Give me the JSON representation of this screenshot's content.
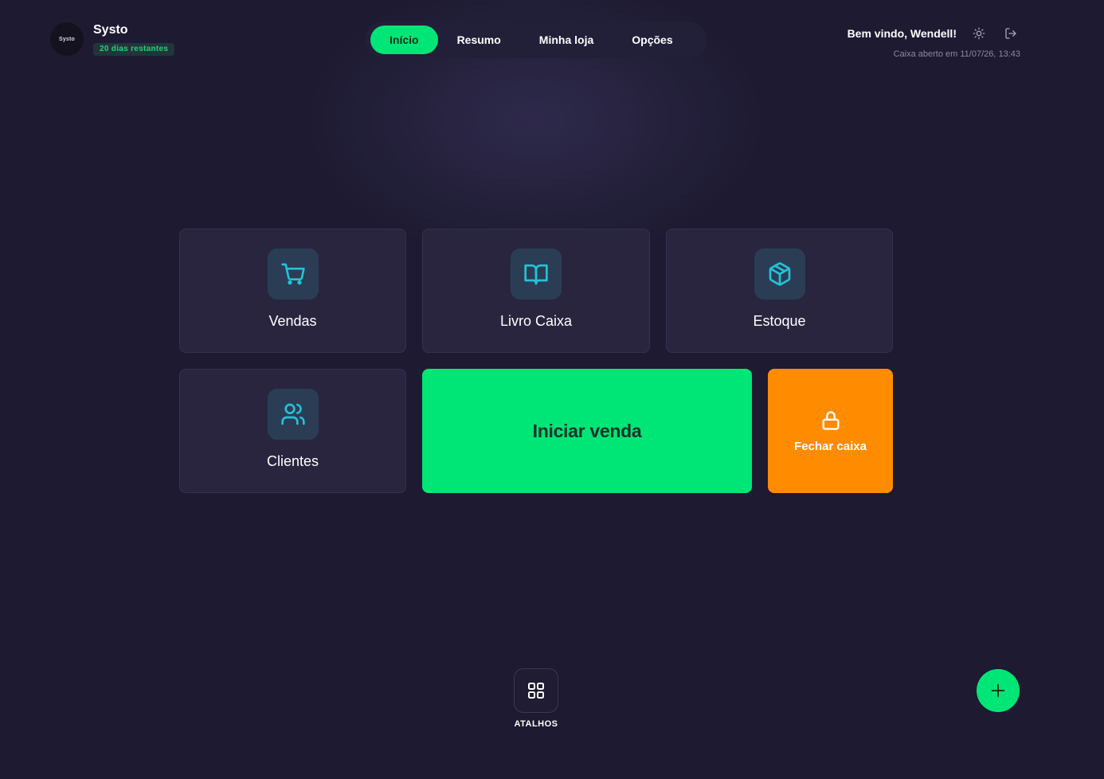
{
  "app": {
    "name": "Systo",
    "logo_text": "Systo",
    "trial_badge": "20 dias restantes"
  },
  "nav": {
    "items": [
      {
        "label": "Início",
        "active": true
      },
      {
        "label": "Resumo",
        "active": false
      },
      {
        "label": "Minha loja",
        "active": false
      },
      {
        "label": "Opções",
        "active": false
      }
    ]
  },
  "user": {
    "welcome": "Bem vindo, Wendell!",
    "cash_status": "Caixa aberto em 11/07/26, 13:43",
    "theme_icon": "sun-icon",
    "logout_icon": "logout-icon"
  },
  "cards": {
    "sales": {
      "label": "Vendas",
      "icon": "shopping-cart-icon"
    },
    "cashbook": {
      "label": "Livro Caixa",
      "icon": "book-open-icon"
    },
    "stock": {
      "label": "Estoque",
      "icon": "package-icon"
    },
    "customers": {
      "label": "Clientes",
      "icon": "users-icon"
    }
  },
  "actions": {
    "start_sale": "Iniciar venda",
    "close_cash": "Fechar caixa",
    "close_cash_icon": "lock-icon"
  },
  "footer": {
    "shortcuts_label": "ATALHOS",
    "shortcuts_icon": "grid-icon",
    "fab_icon": "plus-icon"
  },
  "colors": {
    "background": "#1d1a31",
    "card": "#29253f",
    "accent_green": "#00e676",
    "accent_orange": "#ff8c00",
    "icon_cyan": "#22c3d6"
  }
}
